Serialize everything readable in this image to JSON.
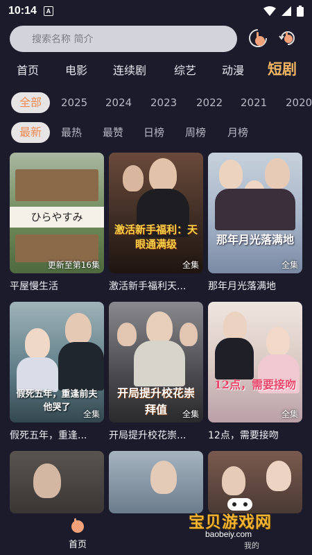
{
  "status": {
    "time": "10:14",
    "notif": "A"
  },
  "search": {
    "placeholder": "搜索名称 简介"
  },
  "icons": {
    "history": "history-hand-icon",
    "refresh": "refresh-hand-icon",
    "home": "home-hand-icon"
  },
  "nav": {
    "tabs": [
      "首页",
      "电影",
      "连续剧",
      "综艺",
      "动漫",
      "短剧"
    ],
    "active": 5
  },
  "years": {
    "items": [
      "全部",
      "2025",
      "2024",
      "2023",
      "2022",
      "2021",
      "2020"
    ],
    "active": 0
  },
  "sort": {
    "items": [
      "最新",
      "最热",
      "最赞",
      "日榜",
      "周榜",
      "月榜"
    ],
    "active": 0
  },
  "cards": [
    {
      "title": "平屋慢生活",
      "badge": "更新至第16集",
      "art": "ひらやすみ",
      "bg": "#6f8a5a"
    },
    {
      "title": "激活新手福利天...",
      "badge": "全集",
      "art": "激活新手福利：天眼通满级",
      "bg": "#3a2a22"
    },
    {
      "title": "那年月光落满地",
      "badge": "全集",
      "art": "那年月光落满地",
      "bg": "#a6b4c8"
    },
    {
      "title": "假死五年，重逢...",
      "badge": "全集",
      "art": "假死五年，重逢前夫他哭了",
      "bg": "#5d7b86"
    },
    {
      "title": "开局提升校花崇...",
      "badge": "全集",
      "art": "开局提升校花崇拜值",
      "bg": "#4b4a4e"
    },
    {
      "title": "12点，需要接吻",
      "badge": "全集",
      "art": "12点，需要接吻",
      "bg": "#d9c8c2"
    },
    {
      "title": "",
      "badge": "",
      "art": "",
      "bg": "#3a3634"
    },
    {
      "title": "",
      "badge": "",
      "art": "",
      "bg": "#6b7c8c"
    },
    {
      "title": "",
      "badge": "",
      "art": "",
      "bg": "#4a3a34"
    }
  ],
  "bottom": {
    "home_label": "首页"
  },
  "watermark": {
    "logo": "宝贝游戏网",
    "url": "baobeiy.com",
    "small": "我的"
  },
  "colors": {
    "background": "#1b1b2b",
    "accent": "#f2b563",
    "chip_selected_text": "#ec8a55"
  }
}
